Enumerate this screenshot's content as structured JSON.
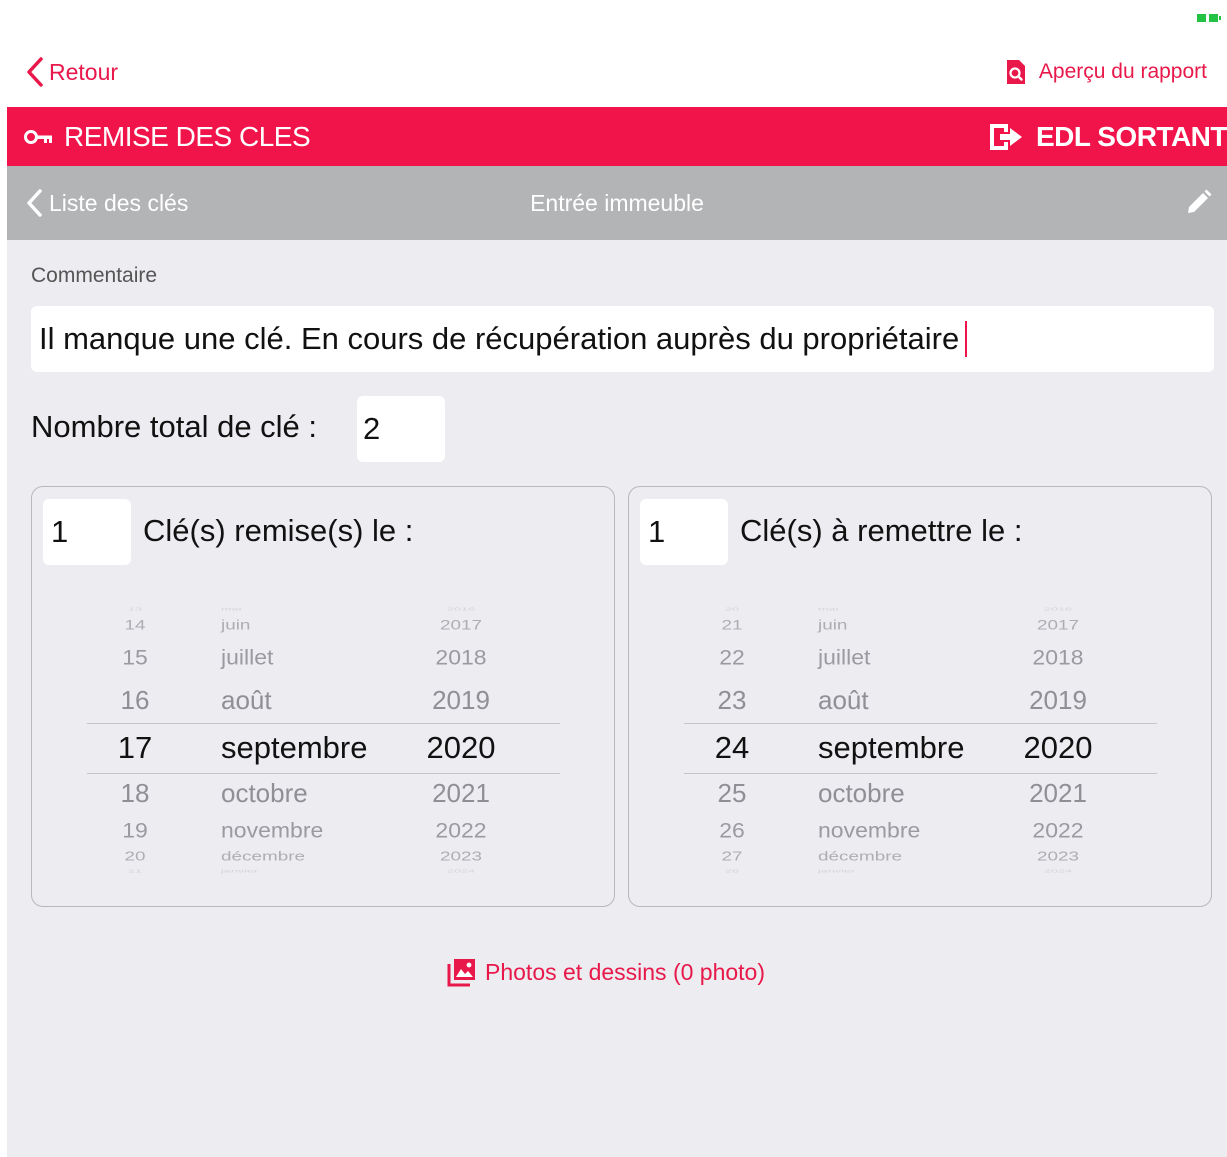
{
  "topbar": {
    "back_label": "Retour",
    "report_label": "Aperçu du rapport"
  },
  "section_bar": {
    "title": "REMISE DES CLES",
    "mode": "EDL SORTANT"
  },
  "sub_bar": {
    "back_label": "Liste des clés",
    "title": "Entrée immeuble"
  },
  "comment": {
    "label": "Commentaire",
    "value": "Il manque une clé. En cours de récupération auprès du propriétaire"
  },
  "total_keys": {
    "label": "Nombre total de clé :",
    "value": "2"
  },
  "handed_over": {
    "count": "1",
    "label": "Clé(s) remise(s) le :",
    "picker": {
      "days": [
        "13",
        "14",
        "15",
        "16",
        "17",
        "18",
        "19",
        "20",
        "21"
      ],
      "months": [
        "mai",
        "juin",
        "juillet",
        "août",
        "septembre",
        "octobre",
        "novembre",
        "décembre",
        "janvier"
      ],
      "years": [
        "2016",
        "2017",
        "2018",
        "2019",
        "2020",
        "2021",
        "2022",
        "2023",
        "2024"
      ],
      "selected": {
        "day": "17",
        "month": "septembre",
        "year": "2020"
      }
    }
  },
  "to_hand_over": {
    "count": "1",
    "label": "Clé(s) à remettre le :",
    "picker": {
      "days": [
        "20",
        "21",
        "22",
        "23",
        "24",
        "25",
        "26",
        "27",
        "28"
      ],
      "months": [
        "mai",
        "juin",
        "juillet",
        "août",
        "septembre",
        "octobre",
        "novembre",
        "décembre",
        "janvier"
      ],
      "years": [
        "2016",
        "2017",
        "2018",
        "2019",
        "2020",
        "2021",
        "2022",
        "2023",
        "2024"
      ],
      "selected": {
        "day": "24",
        "month": "septembre",
        "year": "2020"
      }
    }
  },
  "photos": {
    "label": "Photos et dessins (0 photo)"
  },
  "colors": {
    "accent": "#e8194a",
    "bar_red": "#f0144a",
    "bar_gray": "#b3b4b6",
    "background": "#ececf1"
  },
  "icons": {
    "back": "chevron-left-icon",
    "report": "report-preview-icon",
    "key": "key-icon",
    "exit": "exit-icon",
    "edit": "pencil-icon",
    "photos": "photos-icon"
  }
}
